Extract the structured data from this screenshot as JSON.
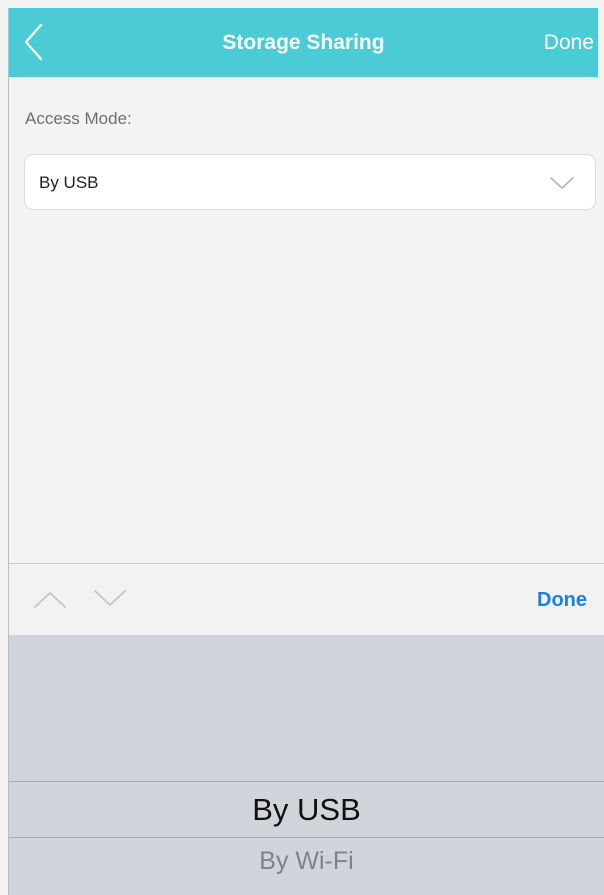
{
  "navbar": {
    "title": "Storage Sharing",
    "done_label": "Done",
    "back_icon": "chevron-left-icon",
    "color": "#4acbd6"
  },
  "form": {
    "access_mode_label": "Access Mode:",
    "access_mode_value": "By USB",
    "dropdown_icon": "chevron-down-icon"
  },
  "toolbar": {
    "prev_icon": "chevron-up-icon",
    "next_icon": "chevron-down-icon",
    "done_label": "Done",
    "done_color": "#1f7fe0"
  },
  "picker": {
    "options": [
      "By USB",
      "By Wi-Fi"
    ],
    "selected": "By USB"
  }
}
